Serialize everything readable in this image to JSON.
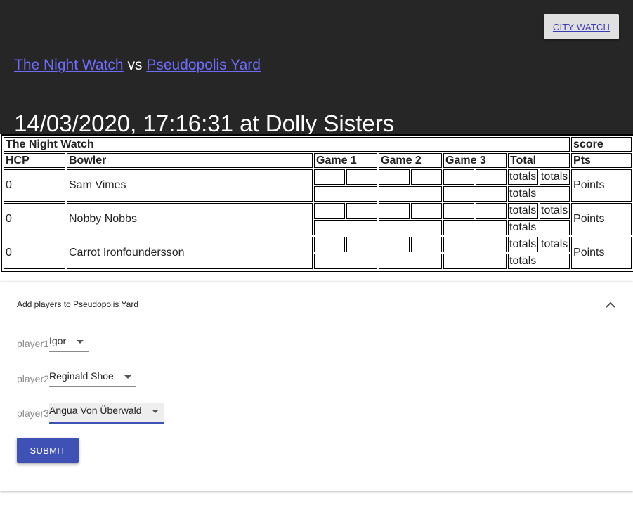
{
  "header": {
    "city_button": "CITY WATCH",
    "home_team": "The Night Watch",
    "vs": "vs",
    "away_team": "Pseudopolis Yard",
    "datetime_venue": "14/03/2020, 17:16:31 at Dolly Sisters"
  },
  "scoresheet": {
    "team_name": "The Night Watch",
    "score_label": "score",
    "columns": {
      "hcp": "HCP",
      "bowler": "Bowler",
      "game1": "Game 1",
      "game2": "Game 2",
      "game3": "Game 3",
      "total": "Total",
      "pts": "Pts"
    },
    "rows": [
      {
        "hcp": "0",
        "bowler": "Sam Vimes",
        "total_a": "totals",
        "total_b": "totals",
        "total_c": "totals",
        "points": "Points"
      },
      {
        "hcp": "0",
        "bowler": "Nobby Nobbs",
        "total_a": "totals",
        "total_b": "totals",
        "total_c": "totals",
        "points": "Points"
      },
      {
        "hcp": "0",
        "bowler": "Carrot Ironfoundersson",
        "total_a": "totals",
        "total_b": "totals",
        "total_c": "totals",
        "points": "Points"
      }
    ]
  },
  "add_players": {
    "title": "Add players to Pseudopolis Yard",
    "players": [
      {
        "label": "player1",
        "value": "Igor"
      },
      {
        "label": "player2",
        "value": "Reginald Shoe"
      },
      {
        "label": "player3",
        "value": "Angua Von Überwald"
      }
    ],
    "submit": "SUBMIT"
  }
}
